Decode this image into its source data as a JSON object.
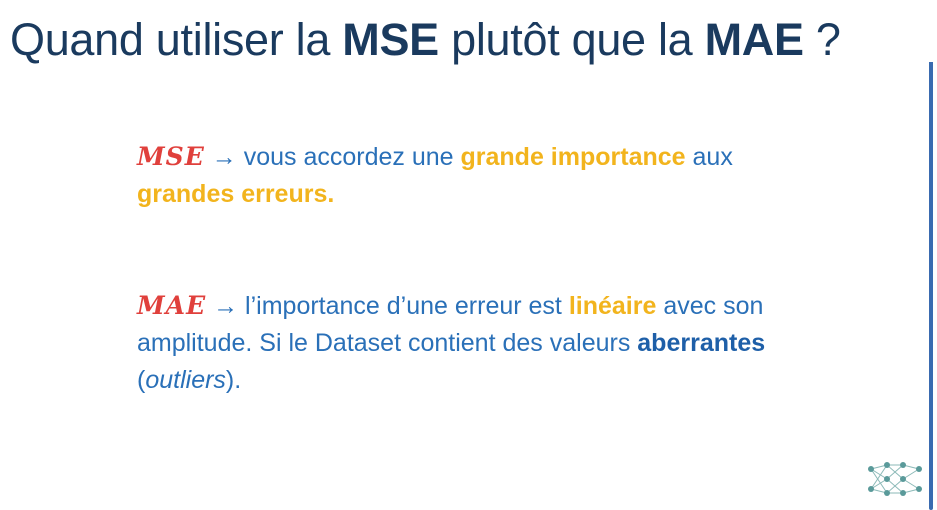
{
  "title": {
    "part1": "Quand utiliser la ",
    "term1": "MSE",
    "part2": " plutôt que la ",
    "term2": "MAE",
    "part3": " ?"
  },
  "mse_paragraph": {
    "term": "MSE",
    "arrow": " → ",
    "text1": "vous accordez une ",
    "highlight1": "grande importance",
    "text2": " aux ",
    "highlight2": "grandes erreurs."
  },
  "mae_paragraph": {
    "term": "MAE",
    "arrow": " → ",
    "text1": "l’importance d’une erreur est ",
    "highlight1": "linéaire",
    "text2": " avec son amplitude. Si le Dataset contient des valeurs ",
    "highlight2": "aberrantes",
    "text3": " (",
    "italic": "outliers",
    "text4": ")."
  },
  "colors": {
    "title": "#1a3a5e",
    "body": "#2a70b8",
    "term": "#e0403c",
    "highlight_yellow": "#f2b41d",
    "highlight_blue": "#1e5fa8",
    "logo": "#5a9a9a"
  },
  "logo_icon": "neural-network-icon"
}
